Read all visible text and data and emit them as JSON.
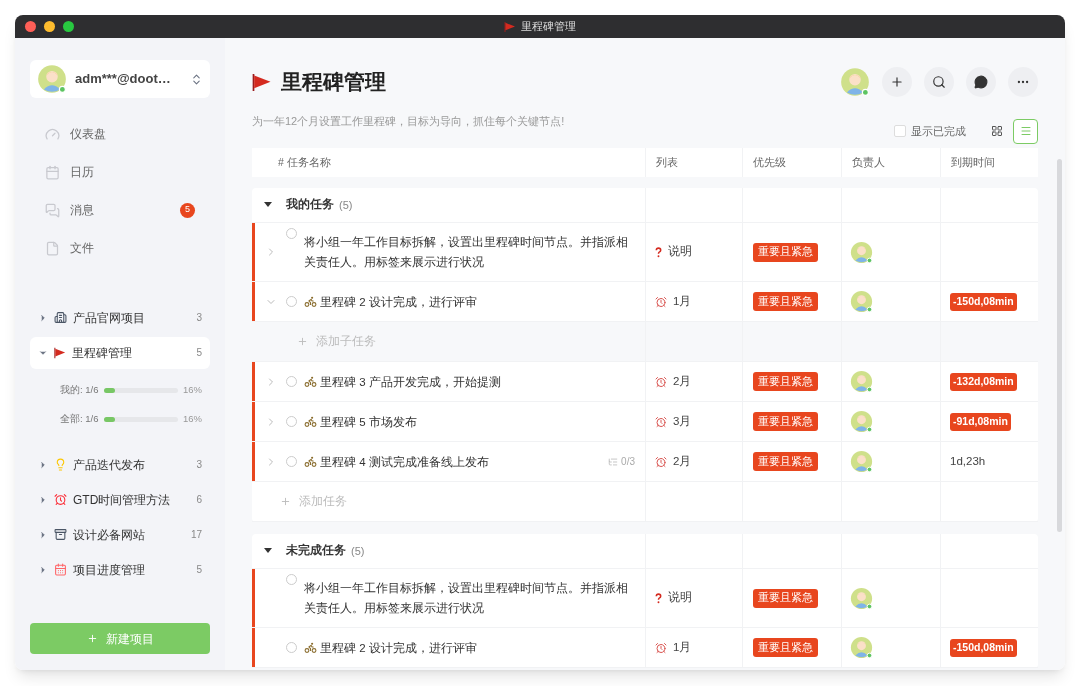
{
  "window": {
    "title": "里程碑管理"
  },
  "account": {
    "name": "adm***@doot…"
  },
  "nav": [
    {
      "kind": "dashboard",
      "label": "仪表盘"
    },
    {
      "kind": "calendar",
      "label": "日历"
    },
    {
      "kind": "messages",
      "label": "消息",
      "badge": "5"
    },
    {
      "kind": "file",
      "label": "文件"
    }
  ],
  "projects": [
    {
      "kind": "building",
      "label": "产品官网项目",
      "count": "3",
      "expanded": false,
      "selected": false
    },
    {
      "kind": "flag",
      "label": "里程碑管理",
      "count": "5",
      "expanded": true,
      "selected": true,
      "progress": [
        {
          "label": "我的: 1/6",
          "level": 0.16,
          "percent": "16%"
        },
        {
          "label": "全部: 1/6",
          "level": 0.16,
          "percent": "16%"
        }
      ]
    },
    {
      "kind": "bulb",
      "label": "产品迭代发布",
      "count": "3",
      "expanded": false,
      "selected": false
    },
    {
      "kind": "alarm",
      "label": "GTD时间管理方法",
      "count": "6",
      "expanded": false,
      "selected": false
    },
    {
      "kind": "box",
      "label": "设计必备网站",
      "count": "17",
      "expanded": false,
      "selected": false
    },
    {
      "kind": "calendar",
      "label": "项目进度管理",
      "count": "5",
      "expanded": false,
      "selected": false
    }
  ],
  "new_project": "新建项目",
  "header": {
    "title": "里程碑管理",
    "subtitle": "为一年12个月设置工作里程碑，目标为导向，抓住每个关键节点!",
    "show_completed": {
      "label": "显示已完成",
      "checked": false
    },
    "views": [
      {
        "kind": "grid",
        "selected": false
      },
      {
        "kind": "list",
        "selected": true
      }
    ]
  },
  "columns": [
    "# 任务名称",
    "列表",
    "优先级",
    "负责人",
    "到期时间"
  ],
  "groups": [
    {
      "title": "我的任务",
      "count": "(5)",
      "expanded": true,
      "rows": [
        {
          "kind": "task",
          "expanded": false,
          "checked": false,
          "milestone": false,
          "title": "将小组一年工作目标拆解，设置出里程碑时间节点。并指派相关责任人。用标签来展示进行状况",
          "list": {
            "kind": "note",
            "label": "说明"
          },
          "priority": "重要且紧急"
        },
        {
          "kind": "task",
          "expanded": true,
          "checked": false,
          "milestone": true,
          "title": "里程碑 2 设计完成，进行评审",
          "list": {
            "kind": "month",
            "label": "1月"
          },
          "priority": "重要且紧急",
          "due": {
            "text": "-150d,08min",
            "overdue": true
          }
        },
        {
          "kind": "add_subtask",
          "label": "添加子任务"
        },
        {
          "kind": "task",
          "expanded": false,
          "checked": false,
          "milestone": true,
          "title": "里程碑 3 产品开发完成，开始提测",
          "list": {
            "kind": "month",
            "label": "2月"
          },
          "priority": "重要且紧急",
          "due": {
            "text": "-132d,08min",
            "overdue": true
          }
        },
        {
          "kind": "task",
          "expanded": false,
          "checked": false,
          "milestone": true,
          "title": "里程碑 5 市场发布",
          "list": {
            "kind": "month",
            "label": "3月"
          },
          "priority": "重要且紧急",
          "due": {
            "text": "-91d,08min",
            "overdue": true
          }
        },
        {
          "kind": "task",
          "expanded": false,
          "checked": false,
          "milestone": true,
          "title": "里程碑 4 测试完成准备线上发布",
          "subtasks": "0/3",
          "list": {
            "kind": "month",
            "label": "2月"
          },
          "priority": "重要且紧急",
          "due": {
            "text": "1d,23h",
            "overdue": false
          }
        },
        {
          "kind": "add_task",
          "label": "添加任务"
        }
      ]
    },
    {
      "title": "未完成任务",
      "count": "(5)",
      "expanded": true,
      "rows": [
        {
          "kind": "task",
          "checked": false,
          "milestone": false,
          "title": "将小组一年工作目标拆解，设置出里程碑时间节点。并指派相关责任人。用标签来展示进行状况",
          "list": {
            "kind": "note",
            "label": "说明"
          },
          "priority": "重要且紧急"
        },
        {
          "kind": "task",
          "checked": false,
          "milestone": true,
          "title": "里程碑 2 设计完成，进行评审",
          "list": {
            "kind": "month",
            "label": "1月"
          },
          "priority": "重要且紧急",
          "due": {
            "text": "-150d,08min",
            "overdue": true
          }
        }
      ]
    }
  ]
}
